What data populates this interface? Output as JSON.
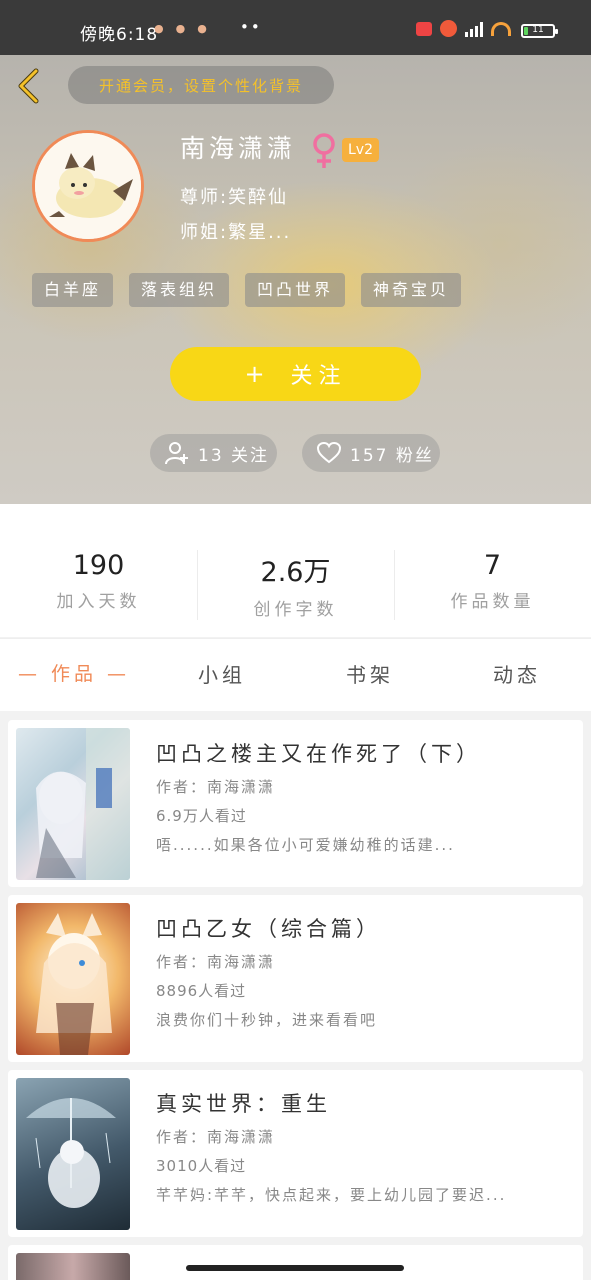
{
  "status_bar": {
    "time": "傍晚6:18",
    "more": "••",
    "battery": "11"
  },
  "header": {
    "vip_banner": "开通会员，设置个性化背景",
    "username": "南海潇潇",
    "level": "Lv2",
    "master": "尊师:笑醉仙",
    "senior": "师姐:繁星...",
    "tags": [
      "白羊座",
      "落表组织",
      "凹凸世界",
      "神奇宝贝"
    ],
    "follow_button": "关注",
    "follow_plus": "+",
    "following": "13 关注",
    "fans": "157 粉丝"
  },
  "stats": [
    {
      "value": "190",
      "label": "加入天数"
    },
    {
      "value": "2.6万",
      "label": "创作字数"
    },
    {
      "value": "7",
      "label": "作品数量"
    }
  ],
  "tabs": [
    "— 作品 —",
    "小组",
    "书架",
    "动态"
  ],
  "works": [
    {
      "title": "凹凸之楼主又在作死了（下）",
      "author": "作者：南海潇潇",
      "views": "6.9万人看过",
      "desc": "唔......如果各位小可爱嫌幼稚的话建..."
    },
    {
      "title": "凹凸乙女（综合篇）",
      "author": "作者：南海潇潇",
      "views": "8896人看过",
      "desc": "浪费你们十秒钟，进来看看吧"
    },
    {
      "title": "真实世界：重生",
      "author": "作者：南海潇潇",
      "views": "3010人看过",
      "desc": "芊芊妈:芊芊，快点起来，要上幼儿园了要迟..."
    }
  ],
  "colors": {
    "accent": "#f08a57",
    "follow": "#f8d716",
    "level": "#f6b03d",
    "vip_text": "#f4c12a"
  }
}
